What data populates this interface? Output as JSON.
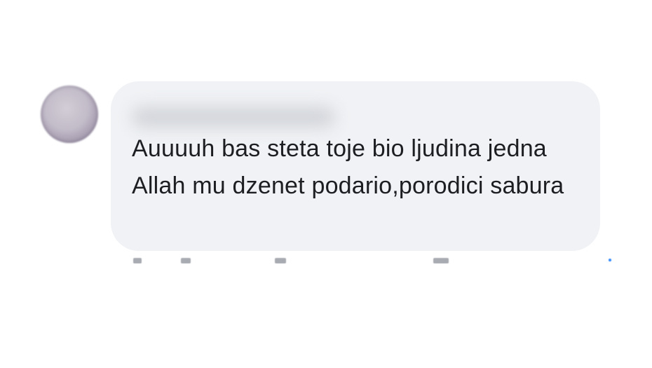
{
  "comment": {
    "author_name": "",
    "text": "Auuuuh bas steta toje bio ljudina jedna Allah mu dzenet podario,porodici sabura"
  },
  "colors": {
    "bubble_bg": "#f0f2f5",
    "text": "#1c1e21",
    "page_bg": "#ffffff"
  },
  "icons": {
    "avatar": "user-avatar"
  }
}
